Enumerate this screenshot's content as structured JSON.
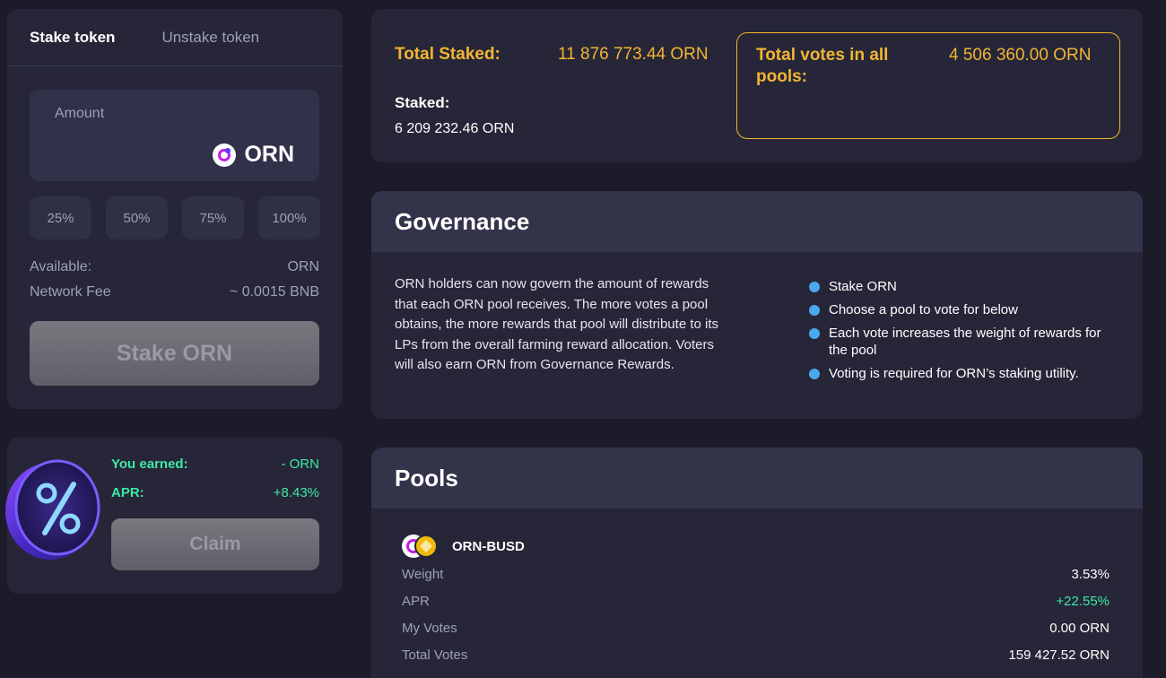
{
  "stake": {
    "tabs": [
      {
        "label": "Stake token",
        "active": true
      },
      {
        "label": "Unstake token",
        "active": false
      }
    ],
    "amount_label": "Amount",
    "token": "ORN",
    "percent_buttons": [
      "25%",
      "50%",
      "75%",
      "100%"
    ],
    "available_label": "Available:",
    "available_value": "ORN",
    "fee_label": "Network Fee",
    "fee_value": "~ 0.0015 BNB",
    "submit_label": "Stake ORN"
  },
  "earned": {
    "earned_label": "You earned:",
    "earned_value": "- ORN",
    "apr_label": "APR:",
    "apr_value": "+8.43%",
    "claim_label": "Claim",
    "medal_icon": "percent-medal-icon"
  },
  "totals": {
    "total_staked_label": "Total Staked:",
    "total_staked_value": "11 876 773.44 ORN",
    "staked_label": "Staked:",
    "staked_value": "6 209 232.46 ORN",
    "total_votes_label": "Total votes in all pools:",
    "total_votes_value": "4 506 360.00 ORN"
  },
  "governance": {
    "title": "Governance",
    "description": "ORN holders can now govern the amount of rewards that each ORN pool receives. The more votes a pool obtains, the more rewards that pool will distribute to its LPs from the overall farming reward allocation. Voters will also earn ORN from Governance Rewards.",
    "steps": [
      "Stake ORN",
      "Choose a pool to vote for below",
      "Each vote increases the weight of rewards for the pool",
      "Voting is required for ORN’s staking utility."
    ]
  },
  "pools": {
    "title": "Pools",
    "items": [
      {
        "name": "ORN-BUSD",
        "weight_label": "Weight",
        "weight_value": "3.53%",
        "apr_label": "APR",
        "apr_value": "+22.55%",
        "my_votes_label": "My Votes",
        "my_votes_value": "0.00 ORN",
        "total_votes_label": "Total Votes",
        "total_votes_value": "159 427.52 ORN"
      }
    ]
  },
  "colors": {
    "background": "#1b1b2a",
    "card": "#262638",
    "accent_gold": "#f2b531",
    "accent_green": "#3ee8a6",
    "bullet_blue": "#4aa8ec"
  }
}
